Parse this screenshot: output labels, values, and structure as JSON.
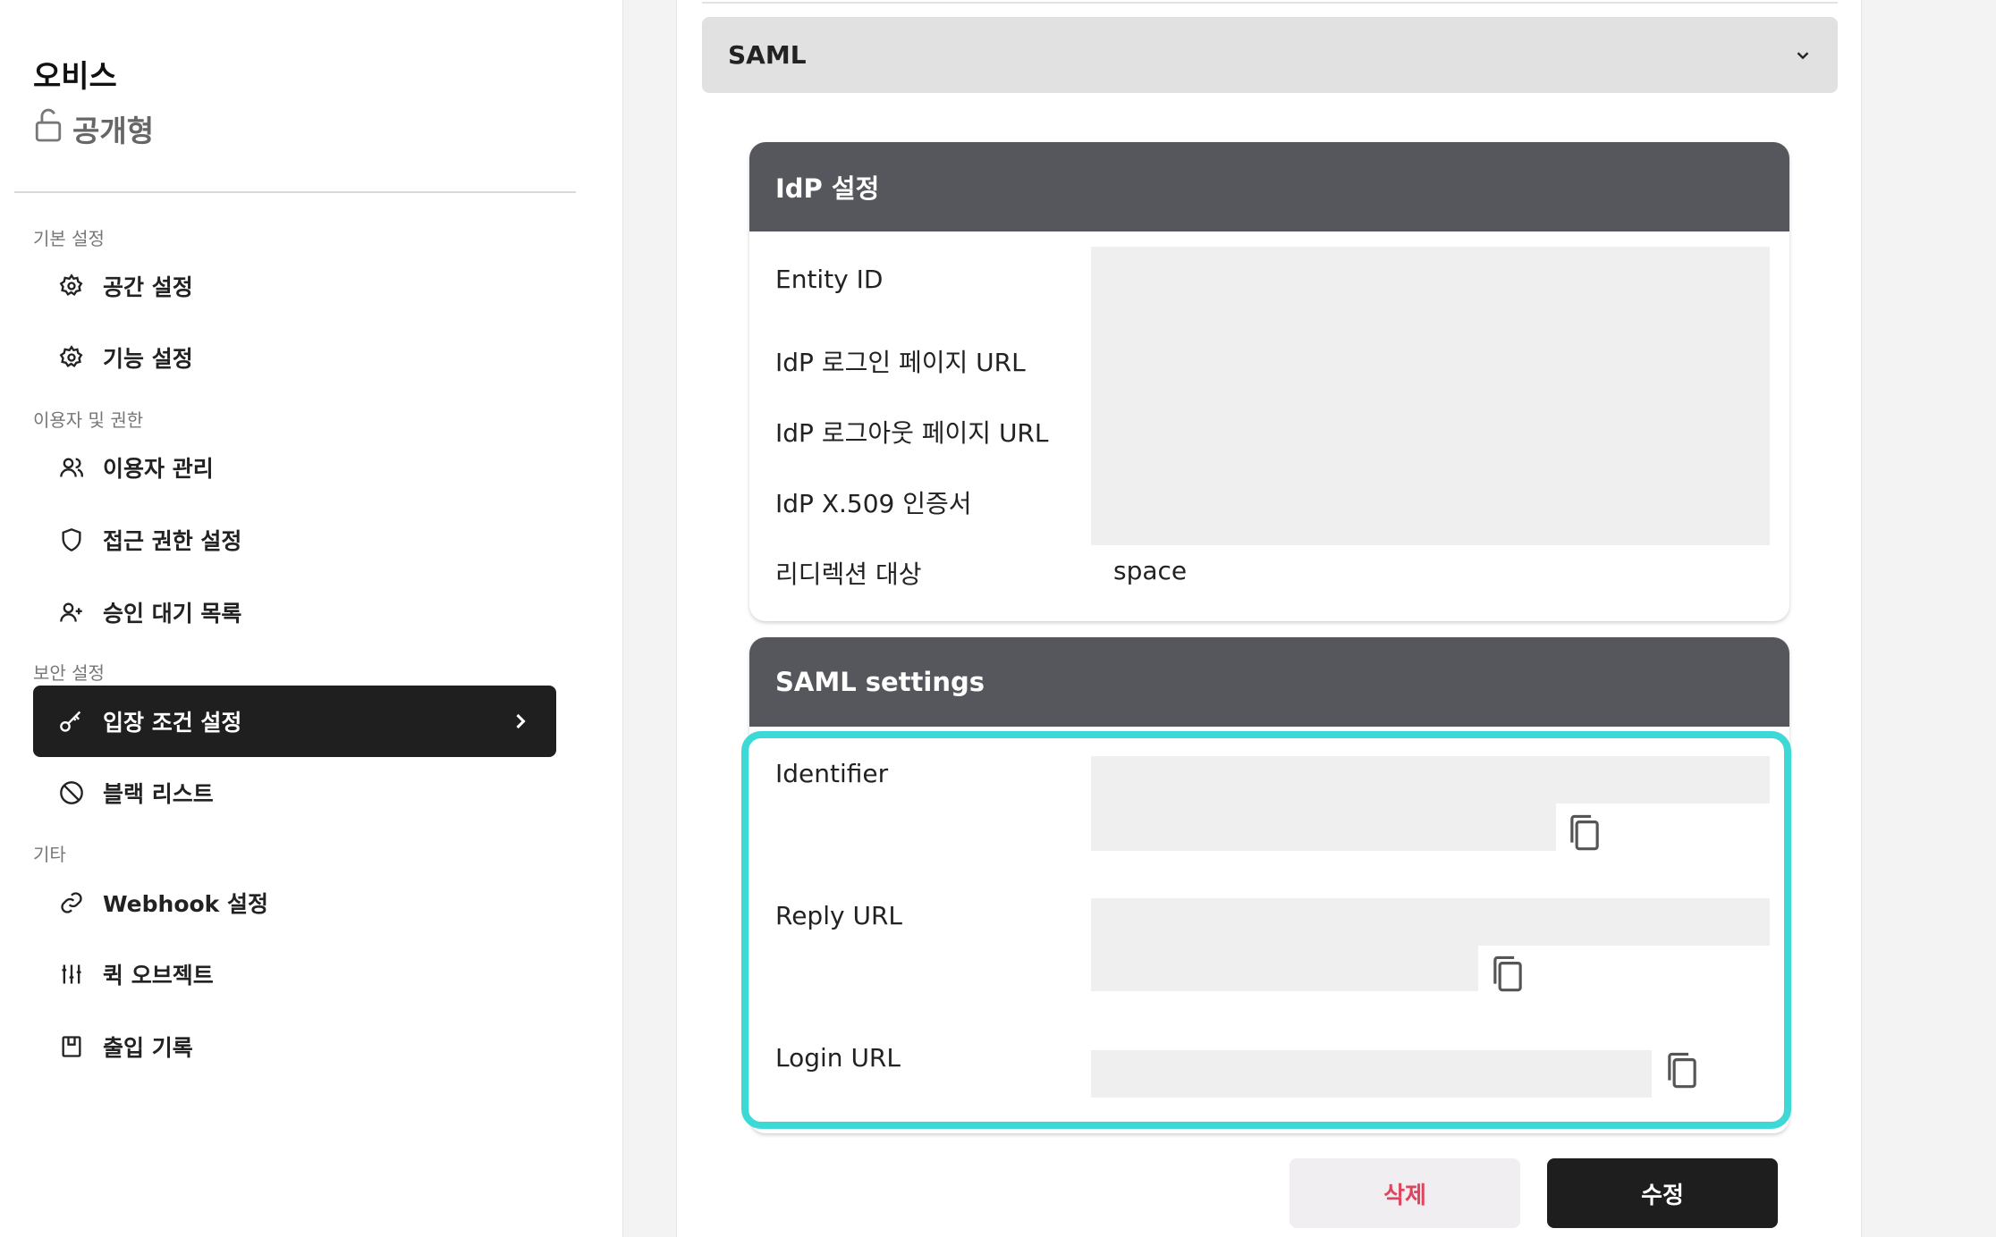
{
  "space": {
    "name": "오비스",
    "type": "공개형"
  },
  "sidebar": {
    "sections": [
      {
        "label": "기본 설정",
        "items": [
          {
            "label": "공간 설정",
            "icon": "gear-icon"
          },
          {
            "label": "기능 설정",
            "icon": "gear-icon"
          }
        ]
      },
      {
        "label": "이용자 및 권한",
        "items": [
          {
            "label": "이용자 관리",
            "icon": "users-icon"
          },
          {
            "label": "접근 권한 설정",
            "icon": "shield-icon"
          },
          {
            "label": "승인 대기 목록",
            "icon": "user-plus-icon"
          }
        ]
      },
      {
        "label": "보안 설정",
        "items": [
          {
            "label": "입장 조건 설정",
            "icon": "key-icon",
            "active": true
          },
          {
            "label": "블랙 리스트",
            "icon": "ban-icon"
          }
        ]
      },
      {
        "label": "기타",
        "items": [
          {
            "label": "Webhook 설정",
            "icon": "link-icon"
          },
          {
            "label": "퀵 오브젝트",
            "icon": "sliders-icon"
          },
          {
            "label": "출입 기록",
            "icon": "log-book-icon"
          }
        ]
      }
    ]
  },
  "main": {
    "protocol_select": {
      "value": "SAML"
    },
    "idp_panel": {
      "title": "IdP 설정",
      "fields": {
        "entity_id": "Entity ID",
        "login_url": "IdP 로그인 페이지 URL",
        "logout_url": "IdP 로그아웃 페이지 URL",
        "certificate": "IdP X.509 인증서",
        "redirect_target": "리디렉션 대상"
      },
      "redirect_value": "space"
    },
    "saml_panel": {
      "title": "SAML settings",
      "fields": {
        "identifier": "Identifier",
        "reply_url": "Reply URL",
        "login_url": "Login URL"
      }
    },
    "buttons": {
      "delete": "삭제",
      "edit": "수정"
    }
  },
  "colors": {
    "highlight": "#3dd9d6",
    "delete_text": "#e0455f",
    "panel_header": "#55575c",
    "active_nav": "#1f1f1f"
  }
}
